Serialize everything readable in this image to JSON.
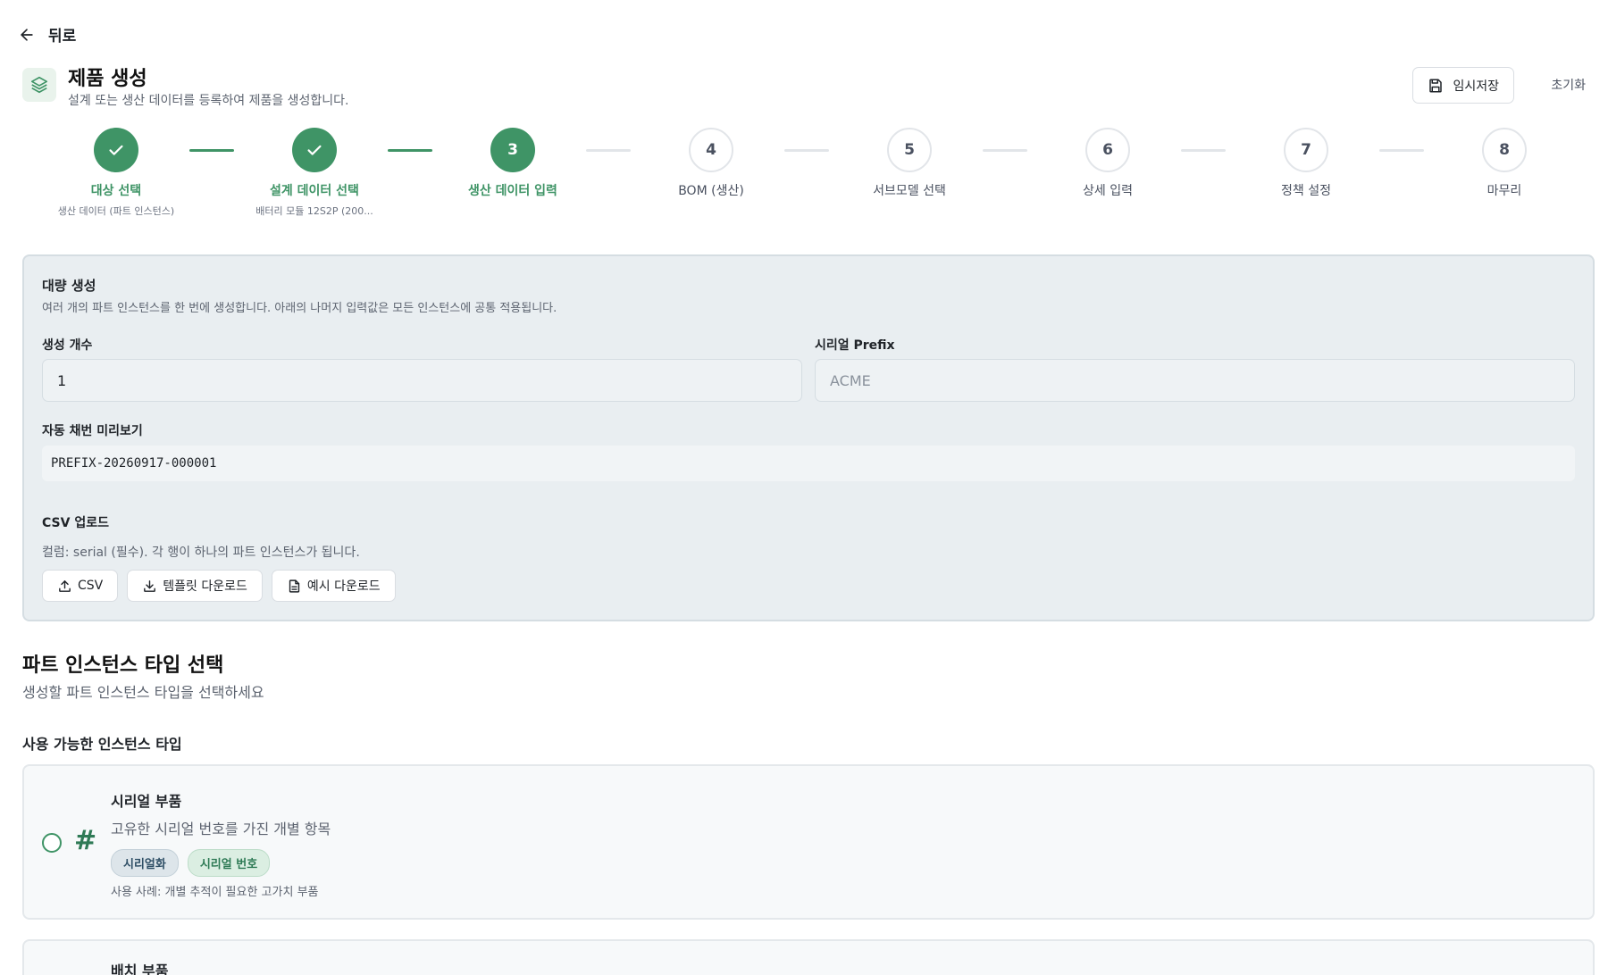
{
  "nav": {
    "back_label": "뒤로"
  },
  "header": {
    "title": "제품 생성",
    "subtitle": "설계 또는 생산 데이터를 등록하여 제품을 생성합니다.",
    "save_label": "임시저장",
    "reset_label": "초기화"
  },
  "stepper": {
    "steps": [
      {
        "number": "1",
        "label": "대상 선택",
        "sub": "생산 데이터 (파트 인스턴스)",
        "state": "done"
      },
      {
        "number": "2",
        "label": "설계 데이터 선택",
        "sub": "배터리 모듈 12S2P (200...",
        "state": "done"
      },
      {
        "number": "3",
        "label": "생산 데이터 입력",
        "sub": "",
        "state": "active"
      },
      {
        "number": "4",
        "label": "BOM (생산)",
        "sub": "",
        "state": "todo"
      },
      {
        "number": "5",
        "label": "서브모델 선택",
        "sub": "",
        "state": "todo"
      },
      {
        "number": "6",
        "label": "상세 입력",
        "sub": "",
        "state": "todo"
      },
      {
        "number": "7",
        "label": "정책 설정",
        "sub": "",
        "state": "todo"
      },
      {
        "number": "8",
        "label": "마무리",
        "sub": "",
        "state": "todo"
      }
    ]
  },
  "bulk": {
    "title": "대량 생성",
    "description": "여러 개의 파트 인스턴스를 한 번에 생성합니다. 아래의 나머지 입력값은 모든 인스턴스에 공통 적용됩니다.",
    "count_label": "생성 개수",
    "count_value": "1",
    "prefix_label": "시리얼 Prefix",
    "prefix_placeholder": "ACME",
    "preview_label": "자동 채번 미리보기",
    "preview_value": "PREFIX-20260917-000001",
    "csv_label": "CSV 업로드",
    "csv_hint": "컬럼: serial (필수). 각 행이 하나의 파트 인스턴스가 됩니다.",
    "csv_button": "CSV",
    "template_button": "템플릿 다운로드",
    "example_button": "예시 다운로드"
  },
  "instance_section": {
    "title": "파트 인스턴스 타입 선택",
    "description": "생성할 파트 인스턴스 타입을 선택하세요",
    "available_label": "사용 가능한 인스턴스 타입",
    "types": [
      {
        "title": "시리얼 부품",
        "description": "고유한 시리얼 번호를 가진 개별 항목",
        "tags": [
          "시리얼화",
          "시리얼 번호"
        ],
        "usage": "사용 사례: 개별 추적이 필요한 고가치 부품",
        "icon": "hash-icon"
      },
      {
        "title": "배치 부품"
      }
    ]
  },
  "colors": {
    "accent": "#3f9466",
    "panel": "#e9eef1"
  }
}
